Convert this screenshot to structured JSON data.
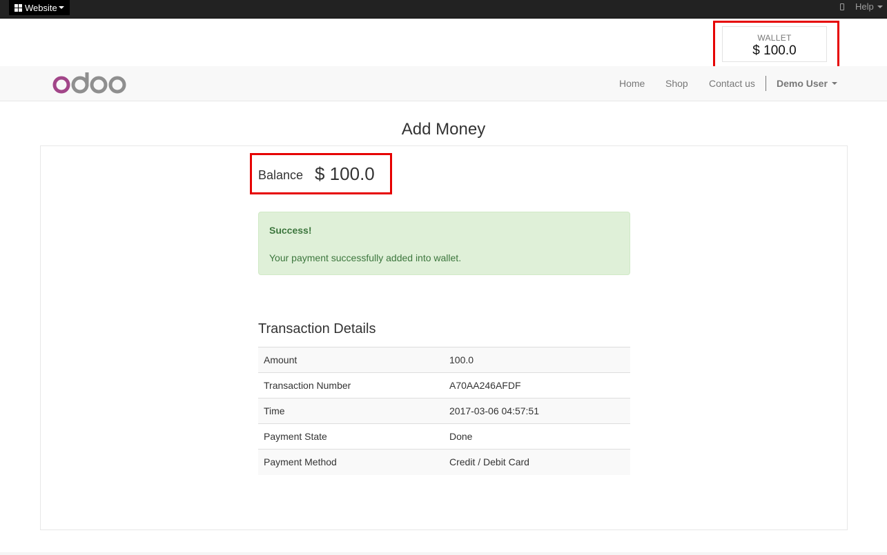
{
  "adminbar": {
    "website_label": "Website",
    "help_label": "Help",
    "icons": [
      "grid-icon",
      "mobile-icon"
    ]
  },
  "wallet": {
    "label": "WALLET",
    "amount": "$ 100.0"
  },
  "navbar": {
    "logo_text": "odoo",
    "items": [
      {
        "label": "Home"
      },
      {
        "label": "Shop"
      },
      {
        "label": "Contact us"
      }
    ],
    "user_label": "Demo User"
  },
  "page": {
    "title": "Add Money",
    "balance_label": "Balance",
    "balance_amount": "$ 100.0"
  },
  "alert": {
    "title": "Success!",
    "message": "Your payment successfully added into wallet."
  },
  "transaction": {
    "heading": "Transaction Details",
    "rows": [
      {
        "key": "Amount",
        "value": "100.0"
      },
      {
        "key": "Transaction Number",
        "value": "A70AA246AFDF"
      },
      {
        "key": "Time",
        "value": "2017-03-06 04:57:51"
      },
      {
        "key": "Payment State",
        "value": "Done"
      },
      {
        "key": "Payment Method",
        "value": "Credit / Debit Card"
      }
    ]
  },
  "colors": {
    "highlight": "#e60000",
    "success_bg": "#dff0d8",
    "success_text": "#3c763d",
    "logo_purple": "#a24689",
    "logo_gray": "#8f8f8f"
  }
}
